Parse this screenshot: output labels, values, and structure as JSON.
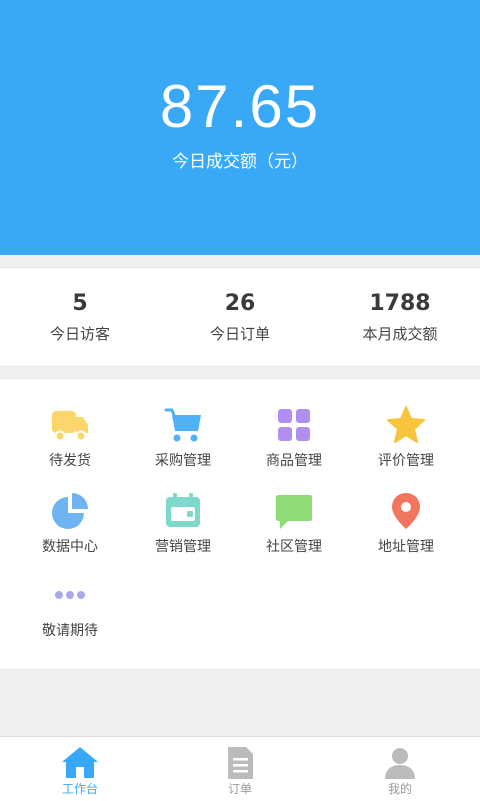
{
  "colors": {
    "primary": "#39a9f7",
    "truck": "#fbd66c",
    "cart": "#4fb2f7",
    "grid": "#b18ff0",
    "star": "#f7c43b",
    "pie": "#6fb3f3",
    "calendar": "#7fd8cc",
    "chat": "#8fdb76",
    "pin": "#f2765e",
    "dots": "#a9a9e8",
    "inactive": "#bbbbbb"
  },
  "hero": {
    "amount": "87.65",
    "amount_label": "今日成交额（元）"
  },
  "stats": [
    {
      "value": "5",
      "label": "今日访客"
    },
    {
      "value": "26",
      "label": "今日订单"
    },
    {
      "value": "1788",
      "label": "本月成交额"
    }
  ],
  "menu": [
    {
      "label": "待发货",
      "icon": "truck-icon"
    },
    {
      "label": "采购管理",
      "icon": "cart-icon"
    },
    {
      "label": "商品管理",
      "icon": "grid-icon"
    },
    {
      "label": "评价管理",
      "icon": "star-icon"
    },
    {
      "label": "数据中心",
      "icon": "pie-chart-icon"
    },
    {
      "label": "营销管理",
      "icon": "calendar-icon"
    },
    {
      "label": "社区管理",
      "icon": "chat-bubble-icon"
    },
    {
      "label": "地址管理",
      "icon": "location-pin-icon"
    },
    {
      "label": "敬请期待",
      "icon": "more-dots-icon"
    }
  ],
  "tabbar": [
    {
      "label": "工作台",
      "icon": "home-icon",
      "active": true
    },
    {
      "label": "订单",
      "icon": "document-icon",
      "active": false
    },
    {
      "label": "我的",
      "icon": "user-icon",
      "active": false
    }
  ]
}
